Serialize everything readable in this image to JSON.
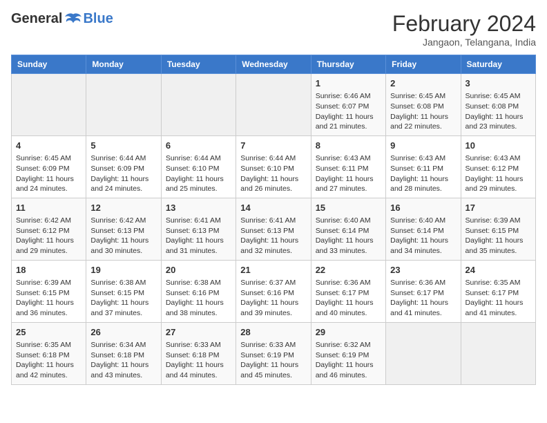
{
  "logo": {
    "general": "General",
    "blue": "Blue"
  },
  "title": "February 2024",
  "subtitle": "Jangaon, Telangana, India",
  "days_of_week": [
    "Sunday",
    "Monday",
    "Tuesday",
    "Wednesday",
    "Thursday",
    "Friday",
    "Saturday"
  ],
  "weeks": [
    [
      {
        "day": "",
        "info": ""
      },
      {
        "day": "",
        "info": ""
      },
      {
        "day": "",
        "info": ""
      },
      {
        "day": "",
        "info": ""
      },
      {
        "day": "1",
        "info": "Sunrise: 6:46 AM\nSunset: 6:07 PM\nDaylight: 11 hours and 21 minutes."
      },
      {
        "day": "2",
        "info": "Sunrise: 6:45 AM\nSunset: 6:08 PM\nDaylight: 11 hours and 22 minutes."
      },
      {
        "day": "3",
        "info": "Sunrise: 6:45 AM\nSunset: 6:08 PM\nDaylight: 11 hours and 23 minutes."
      }
    ],
    [
      {
        "day": "4",
        "info": "Sunrise: 6:45 AM\nSunset: 6:09 PM\nDaylight: 11 hours and 24 minutes."
      },
      {
        "day": "5",
        "info": "Sunrise: 6:44 AM\nSunset: 6:09 PM\nDaylight: 11 hours and 24 minutes."
      },
      {
        "day": "6",
        "info": "Sunrise: 6:44 AM\nSunset: 6:10 PM\nDaylight: 11 hours and 25 minutes."
      },
      {
        "day": "7",
        "info": "Sunrise: 6:44 AM\nSunset: 6:10 PM\nDaylight: 11 hours and 26 minutes."
      },
      {
        "day": "8",
        "info": "Sunrise: 6:43 AM\nSunset: 6:11 PM\nDaylight: 11 hours and 27 minutes."
      },
      {
        "day": "9",
        "info": "Sunrise: 6:43 AM\nSunset: 6:11 PM\nDaylight: 11 hours and 28 minutes."
      },
      {
        "day": "10",
        "info": "Sunrise: 6:43 AM\nSunset: 6:12 PM\nDaylight: 11 hours and 29 minutes."
      }
    ],
    [
      {
        "day": "11",
        "info": "Sunrise: 6:42 AM\nSunset: 6:12 PM\nDaylight: 11 hours and 29 minutes."
      },
      {
        "day": "12",
        "info": "Sunrise: 6:42 AM\nSunset: 6:13 PM\nDaylight: 11 hours and 30 minutes."
      },
      {
        "day": "13",
        "info": "Sunrise: 6:41 AM\nSunset: 6:13 PM\nDaylight: 11 hours and 31 minutes."
      },
      {
        "day": "14",
        "info": "Sunrise: 6:41 AM\nSunset: 6:13 PM\nDaylight: 11 hours and 32 minutes."
      },
      {
        "day": "15",
        "info": "Sunrise: 6:40 AM\nSunset: 6:14 PM\nDaylight: 11 hours and 33 minutes."
      },
      {
        "day": "16",
        "info": "Sunrise: 6:40 AM\nSunset: 6:14 PM\nDaylight: 11 hours and 34 minutes."
      },
      {
        "day": "17",
        "info": "Sunrise: 6:39 AM\nSunset: 6:15 PM\nDaylight: 11 hours and 35 minutes."
      }
    ],
    [
      {
        "day": "18",
        "info": "Sunrise: 6:39 AM\nSunset: 6:15 PM\nDaylight: 11 hours and 36 minutes."
      },
      {
        "day": "19",
        "info": "Sunrise: 6:38 AM\nSunset: 6:15 PM\nDaylight: 11 hours and 37 minutes."
      },
      {
        "day": "20",
        "info": "Sunrise: 6:38 AM\nSunset: 6:16 PM\nDaylight: 11 hours and 38 minutes."
      },
      {
        "day": "21",
        "info": "Sunrise: 6:37 AM\nSunset: 6:16 PM\nDaylight: 11 hours and 39 minutes."
      },
      {
        "day": "22",
        "info": "Sunrise: 6:36 AM\nSunset: 6:17 PM\nDaylight: 11 hours and 40 minutes."
      },
      {
        "day": "23",
        "info": "Sunrise: 6:36 AM\nSunset: 6:17 PM\nDaylight: 11 hours and 41 minutes."
      },
      {
        "day": "24",
        "info": "Sunrise: 6:35 AM\nSunset: 6:17 PM\nDaylight: 11 hours and 41 minutes."
      }
    ],
    [
      {
        "day": "25",
        "info": "Sunrise: 6:35 AM\nSunset: 6:18 PM\nDaylight: 11 hours and 42 minutes."
      },
      {
        "day": "26",
        "info": "Sunrise: 6:34 AM\nSunset: 6:18 PM\nDaylight: 11 hours and 43 minutes."
      },
      {
        "day": "27",
        "info": "Sunrise: 6:33 AM\nSunset: 6:18 PM\nDaylight: 11 hours and 44 minutes."
      },
      {
        "day": "28",
        "info": "Sunrise: 6:33 AM\nSunset: 6:19 PM\nDaylight: 11 hours and 45 minutes."
      },
      {
        "day": "29",
        "info": "Sunrise: 6:32 AM\nSunset: 6:19 PM\nDaylight: 11 hours and 46 minutes."
      },
      {
        "day": "",
        "info": ""
      },
      {
        "day": "",
        "info": ""
      }
    ]
  ]
}
